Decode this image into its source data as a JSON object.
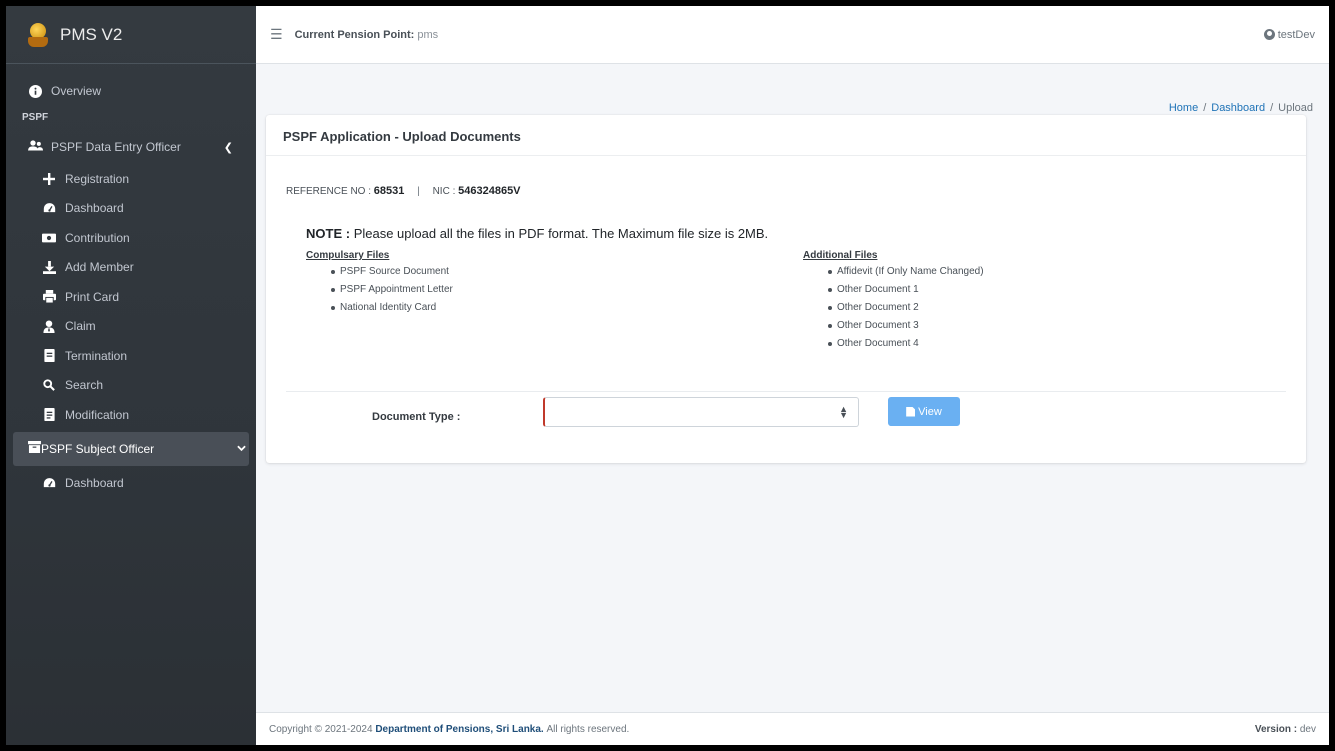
{
  "app": {
    "title": "PMS V2"
  },
  "header": {
    "pension_point_label": "Current Pension Point:",
    "pension_point_value": "pms",
    "user": "testDev"
  },
  "sidebar": {
    "overview": "Overview",
    "section_header": "PSPF",
    "group1": {
      "label": "PSPF Data Entry Officer",
      "items": [
        {
          "label": "Registration",
          "icon": "plus-icon"
        },
        {
          "label": "Dashboard",
          "icon": "tachometer-icon"
        },
        {
          "label": "Contribution",
          "icon": "money-bill-icon"
        },
        {
          "label": "Add Member",
          "icon": "download-icon"
        },
        {
          "label": "Print Card",
          "icon": "print-icon"
        },
        {
          "label": "Claim",
          "icon": "user-tie-icon"
        },
        {
          "label": "Termination",
          "icon": "file-icon"
        },
        {
          "label": "Search",
          "icon": "search-icon"
        },
        {
          "label": "Modification",
          "icon": "file-edit-icon"
        }
      ]
    },
    "group2": {
      "label": "PSPF Subject Officer",
      "items": [
        {
          "label": "Dashboard",
          "icon": "tachometer-icon"
        }
      ]
    }
  },
  "breadcrumb": {
    "home": "Home",
    "sep1": "/",
    "dashboard": "Dashboard",
    "sep2": "/",
    "current": "Upload"
  },
  "card": {
    "title": "PSPF Application - Upload Documents",
    "ref_label": "REFERENCE NO :",
    "ref_value": "68531",
    "pipe": "|",
    "nic_label": "NIC :",
    "nic_value": "546324865V",
    "note_label": "NOTE :",
    "note_text": "Please upload all the files in PDF format. The Maximum file size is 2MB.",
    "compulsory_title": "Compulsary Files",
    "compulsory_files": [
      "PSPF Source Document",
      "PSPF Appointment Letter",
      "National Identity Card"
    ],
    "additional_title": "Additional Files",
    "additional_files": [
      "Affidevit (If Only Name Changed)",
      "Other Document 1",
      "Other Document 2",
      "Other Document 3",
      "Other Document 4"
    ],
    "doc_type_label": "Document Type :",
    "doc_type_value": "",
    "view_button": "View"
  },
  "footer": {
    "copyright_prefix": "Copyright © 2021-2024",
    "org": "Department of Pensions, Sri Lanka.",
    "rights": "All rights reserved.",
    "version_label": "Version :",
    "version_value": "dev"
  },
  "colors": {
    "sidebar_bg": "#343a40",
    "primary": "#6ab0f2",
    "link": "#1f73b7",
    "required": "#c0392b"
  }
}
